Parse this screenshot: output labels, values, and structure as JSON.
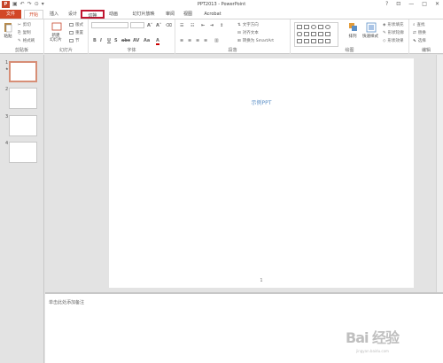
{
  "window": {
    "title": "PPT2013 - PowerPoint",
    "app_icon": "P",
    "qat": [
      "↶",
      "↷",
      "⊙",
      "▾"
    ],
    "controls": [
      "?",
      "⊡",
      "—",
      "□",
      "✕"
    ]
  },
  "tabs": [
    "文件",
    "开始",
    "插入",
    "设计",
    "切换",
    "动画",
    "幻灯片放映",
    "审阅",
    "视图",
    "Acrobat"
  ],
  "ribbon": {
    "clipboard": {
      "label": "剪贴板",
      "paste": "粘贴",
      "cut": "剪切",
      "copy": "复制",
      "format_painter": "格式刷"
    },
    "slides": {
      "label": "幻灯片",
      "new_slide": "新建\n幻灯片",
      "layout": "版式",
      "reset": "重置",
      "section": "节"
    },
    "font": {
      "label": "字体",
      "buttons": [
        "B",
        "I",
        "U",
        "S",
        "abc",
        "AV",
        "Aa",
        "A"
      ]
    },
    "paragraph": {
      "label": "段落",
      "text_direction": "文字方向",
      "align_text": "对齐文本",
      "smartart": "转换为 SmartArt"
    },
    "drawing": {
      "label": "绘图",
      "arrange": "排列",
      "quick_styles": "快速样式",
      "shape_fill": "形状填充",
      "shape_outline": "形状轮廓",
      "shape_effects": "形状效果"
    },
    "editing": {
      "label": "编辑",
      "find": "查找",
      "replace": "替换",
      "select": "选择"
    }
  },
  "thumbnails": [
    {
      "num": "1",
      "star": "★"
    },
    {
      "num": "2"
    },
    {
      "num": "3"
    },
    {
      "num": "4"
    }
  ],
  "slide": {
    "text": "示例PPT",
    "page_number": "1"
  },
  "notes_placeholder": "单击此处添加备注",
  "watermark": {
    "main": "Bai 经验",
    "sub": "jingyan.baidu.com"
  },
  "colors": {
    "file_tab": "#d24726",
    "highlight_box": "#c0152f",
    "slide_text": "#5b8fc7",
    "selected_thumb": "#d78e76"
  }
}
